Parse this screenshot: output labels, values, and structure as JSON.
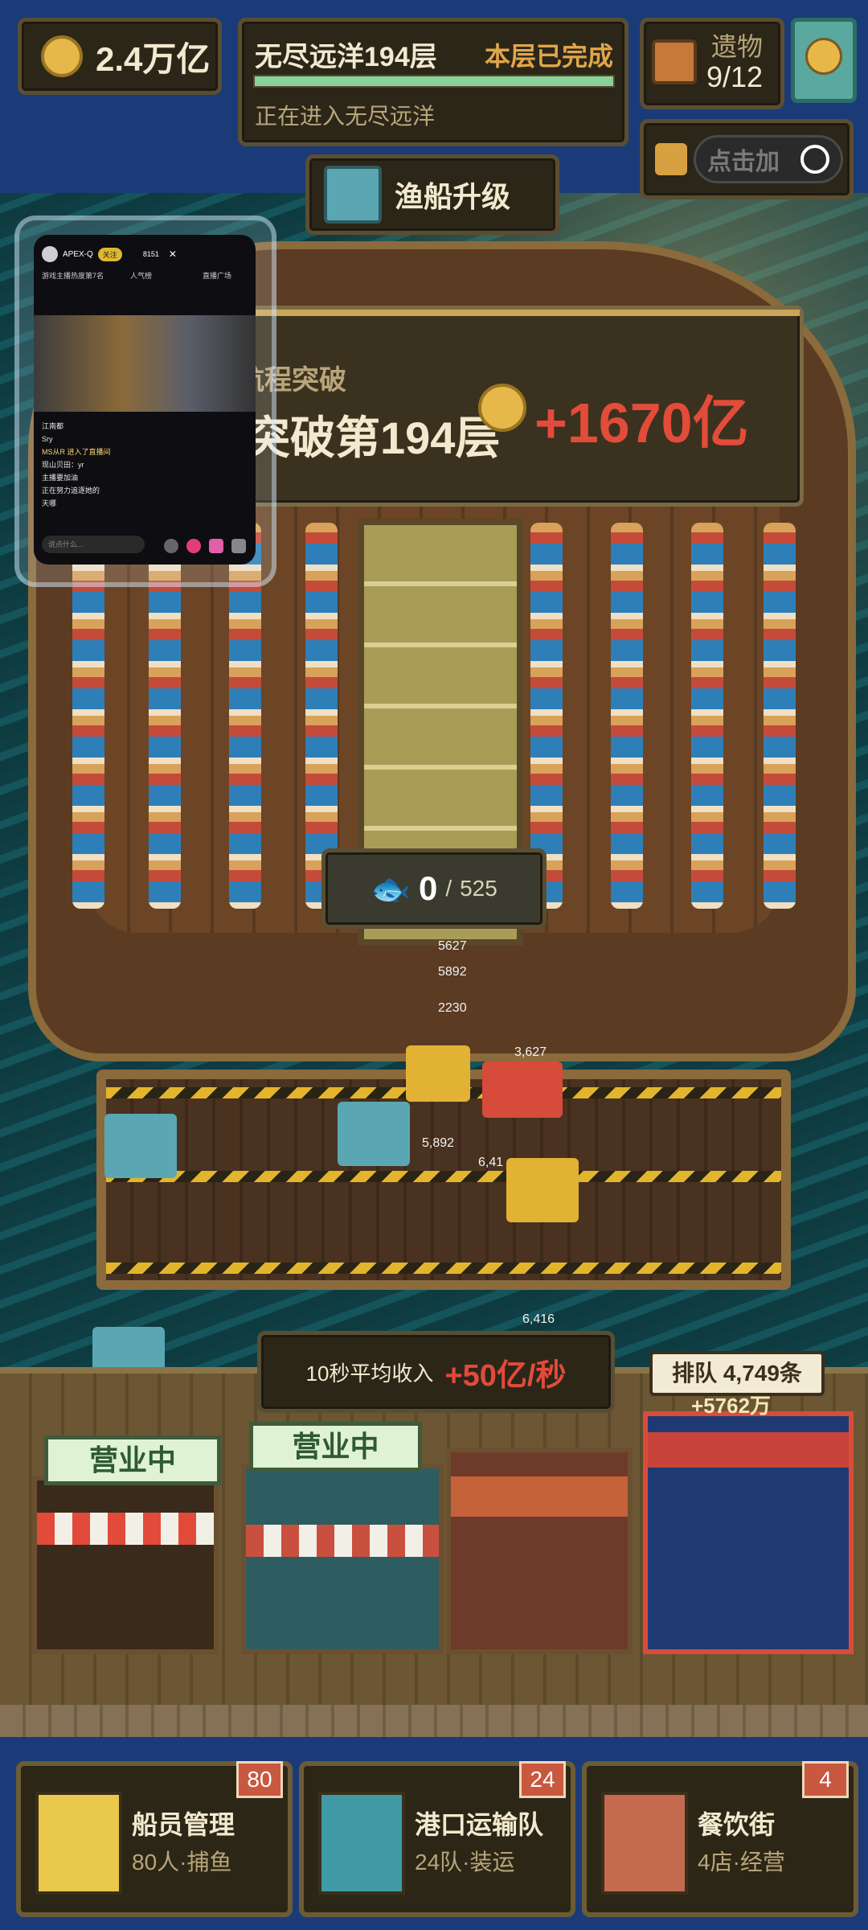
{
  "currency": {
    "amount": "2.4万亿"
  },
  "level": {
    "title": "无尽远洋194层",
    "status": "本层已完成",
    "subtitle": "正在进入无尽远洋",
    "progress": 1.0
  },
  "relics": {
    "label": "遗物",
    "count": "9/12"
  },
  "buttons": {
    "upgrade_label": "渔船升级",
    "mini_text": "点击加"
  },
  "breakthrough": {
    "title": "航程突破",
    "subtitle": "突破第194层",
    "reward": "+1670亿"
  },
  "fish_counter": {
    "current": "0",
    "separator": "/",
    "target": "525"
  },
  "income": {
    "label": "10秒平均收入",
    "value": "+50亿/秒"
  },
  "queue": {
    "text": "排队 4,749条",
    "bonus": "+5762万"
  },
  "shops": [
    {
      "status": "营业中"
    },
    {
      "status": "营业中"
    }
  ],
  "float_numbers": [
    "5627",
    "5892",
    "2230",
    "3,627",
    "5,892",
    "6,41",
    "6,416"
  ],
  "nav": [
    {
      "title": "船员管理",
      "detail": "80人·捕鱼",
      "badge": "80",
      "accent": "#e9c84c"
    },
    {
      "title": "港口运输队",
      "detail": "24队·装运",
      "badge": "24",
      "accent": "#3f9aa6"
    },
    {
      "title": "餐饮街",
      "detail": "4店·经营",
      "badge": "4",
      "accent": "#c46a4f"
    }
  ],
  "live_overlay": {
    "streamer": "APEX-Q",
    "follow_label": "关注",
    "viewers": "8151",
    "tag1": "游戏主播热度第7名",
    "tag2": "人气榜",
    "side_label": "直播广场",
    "comments": [
      "江南都",
      "Sry",
      "MS从R 进入了直播间",
      "现山贝田：yr",
      "主播要加油",
      "正在努力追逐她的",
      "天哪",
      "说点什么..."
    ]
  },
  "colors": {
    "accent_red": "#e14b3b",
    "panel": "#2b2618",
    "border": "#5a4e32",
    "text_cream": "#f3e9cf",
    "text_tan": "#b8a679"
  }
}
